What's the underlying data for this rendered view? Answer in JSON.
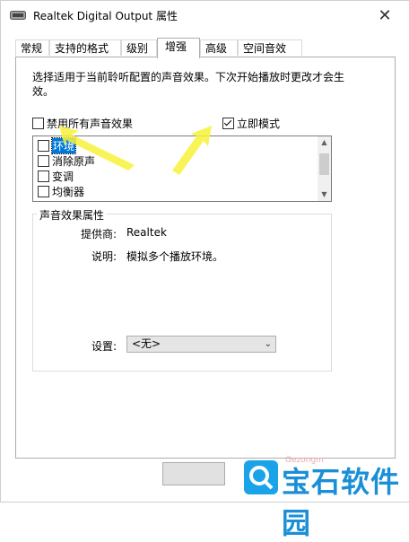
{
  "window": {
    "title": "Realtek Digital Output 属性",
    "close_glyph": "✕"
  },
  "tabs": [
    {
      "label": "常规"
    },
    {
      "label": "支持的格式"
    },
    {
      "label": "级别"
    },
    {
      "label": "增强"
    },
    {
      "label": "高级"
    },
    {
      "label": "空间音效"
    }
  ],
  "active_tab": "增强",
  "description": "选择适用于当前聆听配置的声音效果。下次开始播放时更改才会生效。",
  "disable_all": {
    "label": "禁用所有声音效果",
    "checked": false
  },
  "immediate_mode": {
    "label": "立即模式",
    "checked": true
  },
  "effects": [
    {
      "label": "环境",
      "checked": false,
      "selected": true
    },
    {
      "label": "消除原声",
      "checked": false,
      "selected": false
    },
    {
      "label": "变调",
      "checked": false,
      "selected": false
    },
    {
      "label": "均衡器",
      "checked": false,
      "selected": false
    }
  ],
  "properties": {
    "group_title": "声音效果属性",
    "provider_label": "提供商:",
    "provider_value": "Realtek",
    "description_label": "说明:",
    "description_value": "模拟多个播放环境。",
    "settings_label": "设置:",
    "settings_value": "<无>"
  },
  "watermark": {
    "text": "宝石软件园",
    "url": "Gezongm"
  },
  "colors": {
    "annotation_arrow": "#f7f23a",
    "selection": "#0078d7",
    "watermark": "#1a8fd6"
  }
}
